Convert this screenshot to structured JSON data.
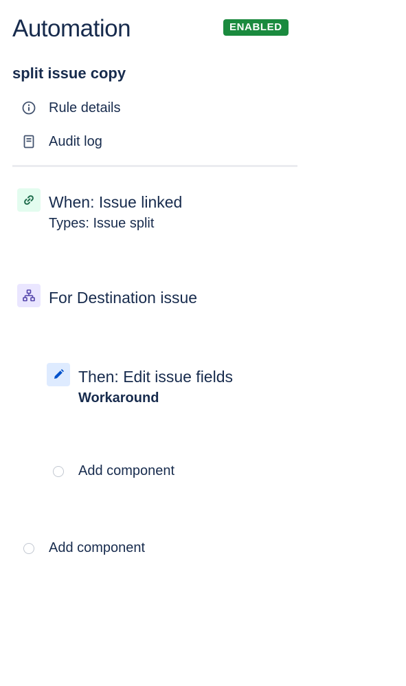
{
  "header": {
    "title": "Automation",
    "status_badge": "ENABLED",
    "status_color": "#1a8a3e"
  },
  "rule": {
    "name": "split issue copy"
  },
  "nav": {
    "items": [
      {
        "label": "Rule details",
        "icon": "info-icon"
      },
      {
        "label": "Audit log",
        "icon": "document-icon"
      }
    ]
  },
  "flow": {
    "trigger": {
      "title": "When: Issue linked",
      "subtitle": "Types: Issue split",
      "icon": "link-icon",
      "icon_bg": "#e3fcef",
      "icon_color": "#216e4e"
    },
    "branch": {
      "title": "For Destination issue",
      "icon": "branch-icon",
      "icon_bg": "#eae6ff",
      "icon_color": "#5243aa"
    },
    "action": {
      "title": "Then: Edit issue fields",
      "subtitle": "Workaround",
      "icon": "pencil-icon",
      "icon_bg": "#deebff",
      "icon_color": "#0052cc"
    },
    "add_component_inner": "Add component",
    "add_component_outer": "Add component"
  }
}
